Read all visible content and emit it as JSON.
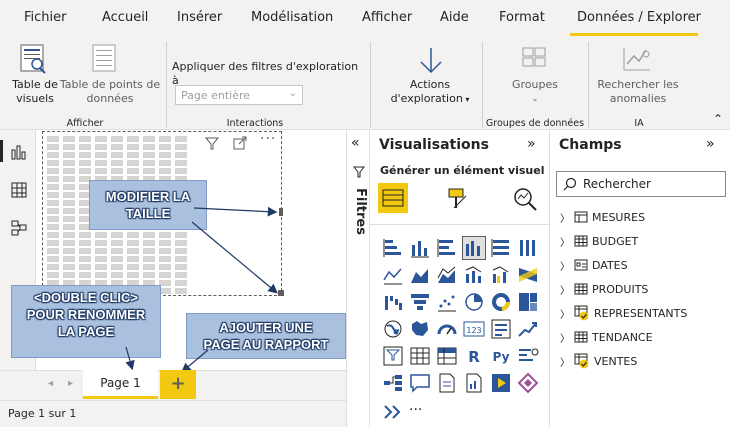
{
  "menu": {
    "items": [
      "Fichier",
      "Accueil",
      "Insérer",
      "Modélisation",
      "Afficher",
      "Aide",
      "Format",
      "Données / Explorer"
    ]
  },
  "ribbon": {
    "table_visuals": "Table de\nvisuels",
    "table_points": "Table de points de\ndonnées",
    "group_afficher": "Afficher",
    "apply_filters": "Appliquer des filtres d'exploration à",
    "dropdown_value": "Page entière",
    "group_interactions": "Interactions",
    "actions_line1": "Actions",
    "actions_line2": "d'exploration",
    "groupes": "Groupes",
    "group_groupes": "Groupes de données",
    "rechercher_anomalies": "Rechercher les\nanomalies",
    "group_ia": "IA"
  },
  "visualisations": {
    "title": "Visualisations",
    "subtitle": "Générer un élément visuel"
  },
  "filters": {
    "label": "Filtres"
  },
  "champs": {
    "title": "Champs",
    "search_placeholder": "Rechercher",
    "tables": [
      "MESURES",
      "BUDGET",
      "DATES",
      "PRODUITS",
      "REPRESENTANTS",
      "TENDANCE",
      "VENTES"
    ]
  },
  "callouts": {
    "resize": "MODIFIER LA\nTAILLE",
    "rename": "<DOUBLE CLIC>\nPOUR RENOMMER\nLA PAGE",
    "add_page": "AJOUTER UNE\nPAGE AU RAPPORT"
  },
  "tabs": {
    "page1": "Page 1",
    "add": "+"
  },
  "status": {
    "text": "Page 1 sur 1"
  },
  "colors": {
    "accent": "#f2c811",
    "callout_bg": "#a9c1de",
    "callout_text_outline": "#1f3864",
    "blue_icon": "#2b579a"
  }
}
